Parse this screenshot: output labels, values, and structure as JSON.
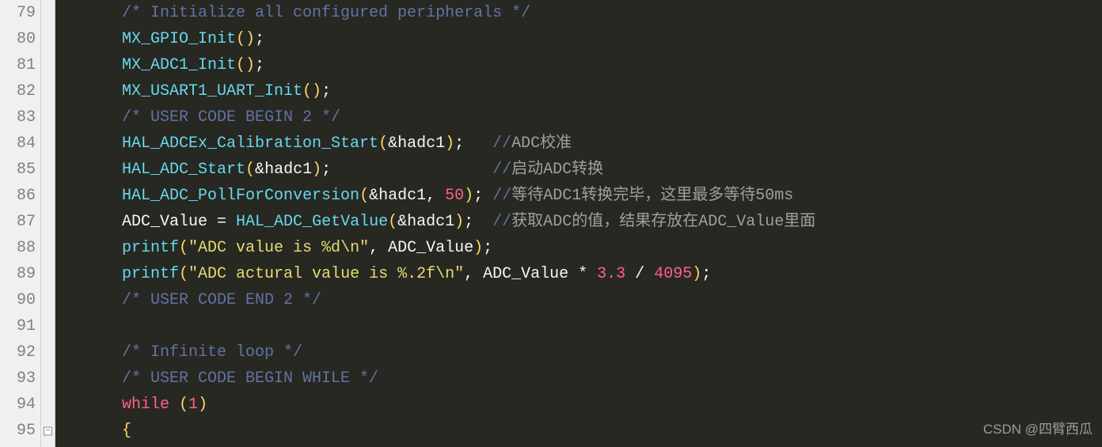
{
  "gutter": {
    "start": 79,
    "end": 95,
    "fold_at": 95
  },
  "code": {
    "l79": {
      "indent": 1,
      "tokens": [
        {
          "t": "/* Initialize all configured peripherals */",
          "c": "c-comment"
        }
      ]
    },
    "l80": {
      "indent": 1,
      "tokens": [
        {
          "t": "MX_GPIO_Init",
          "c": "c-func"
        },
        {
          "t": "()",
          "c": "c-paren"
        },
        {
          "t": ";",
          "c": "c-semi"
        }
      ]
    },
    "l81": {
      "indent": 1,
      "tokens": [
        {
          "t": "MX_ADC1_Init",
          "c": "c-func"
        },
        {
          "t": "()",
          "c": "c-paren"
        },
        {
          "t": ";",
          "c": "c-semi"
        }
      ]
    },
    "l82": {
      "indent": 1,
      "tokens": [
        {
          "t": "MX_USART1_UART_Init",
          "c": "c-func"
        },
        {
          "t": "()",
          "c": "c-paren"
        },
        {
          "t": ";",
          "c": "c-semi"
        }
      ]
    },
    "l83": {
      "indent": 1,
      "tokens": [
        {
          "t": "/* USER CODE BEGIN 2 */",
          "c": "c-comment"
        }
      ]
    },
    "l84": {
      "indent": 1,
      "tokens": [
        {
          "t": "HAL_ADCEx_Calibration_Start",
          "c": "c-func"
        },
        {
          "t": "(",
          "c": "c-paren"
        },
        {
          "t": "&",
          "c": "c-op"
        },
        {
          "t": "hadc1",
          "c": "c-ident"
        },
        {
          "t": ")",
          "c": "c-paren"
        },
        {
          "t": ";",
          "c": "c-semi"
        },
        {
          "t": "   ",
          "c": ""
        },
        {
          "t": "//",
          "c": "c-comment"
        },
        {
          "t": "ADC校准",
          "c": "c-cn"
        }
      ]
    },
    "l85": {
      "indent": 1,
      "tokens": [
        {
          "t": "HAL_ADC_Start",
          "c": "c-func"
        },
        {
          "t": "(",
          "c": "c-paren"
        },
        {
          "t": "&",
          "c": "c-op"
        },
        {
          "t": "hadc1",
          "c": "c-ident"
        },
        {
          "t": ")",
          "c": "c-paren"
        },
        {
          "t": ";",
          "c": "c-semi"
        },
        {
          "t": "                 ",
          "c": ""
        },
        {
          "t": "//",
          "c": "c-comment"
        },
        {
          "t": "启动ADC转换",
          "c": "c-cn"
        }
      ]
    },
    "l86": {
      "indent": 1,
      "tokens": [
        {
          "t": "HAL_ADC_PollForConversion",
          "c": "c-func"
        },
        {
          "t": "(",
          "c": "c-paren"
        },
        {
          "t": "&",
          "c": "c-op"
        },
        {
          "t": "hadc1",
          "c": "c-ident"
        },
        {
          "t": ", ",
          "c": "c-op"
        },
        {
          "t": "50",
          "c": "c-num"
        },
        {
          "t": ")",
          "c": "c-paren"
        },
        {
          "t": ";",
          "c": "c-semi"
        },
        {
          "t": " ",
          "c": ""
        },
        {
          "t": "//",
          "c": "c-comment"
        },
        {
          "t": "等待ADC1转换完毕，这里最多等待50ms",
          "c": "c-cn"
        }
      ]
    },
    "l87": {
      "indent": 1,
      "tokens": [
        {
          "t": "ADC_Value",
          "c": "c-ident"
        },
        {
          "t": " = ",
          "c": "c-op"
        },
        {
          "t": "HAL_ADC_GetValue",
          "c": "c-func"
        },
        {
          "t": "(",
          "c": "c-paren"
        },
        {
          "t": "&",
          "c": "c-op"
        },
        {
          "t": "hadc1",
          "c": "c-ident"
        },
        {
          "t": ")",
          "c": "c-paren"
        },
        {
          "t": ";",
          "c": "c-semi"
        },
        {
          "t": "  ",
          "c": ""
        },
        {
          "t": "//",
          "c": "c-comment"
        },
        {
          "t": "获取ADC的值，结果存放在ADC_Value里面",
          "c": "c-cn"
        }
      ]
    },
    "l88": {
      "indent": 1,
      "tokens": [
        {
          "t": "printf",
          "c": "c-func"
        },
        {
          "t": "(",
          "c": "c-paren"
        },
        {
          "t": "\"ADC value is %d\\n\"",
          "c": "c-str"
        },
        {
          "t": ", ",
          "c": "c-op"
        },
        {
          "t": "ADC_Value",
          "c": "c-ident"
        },
        {
          "t": ")",
          "c": "c-paren"
        },
        {
          "t": ";",
          "c": "c-semi"
        }
      ]
    },
    "l89": {
      "indent": 1,
      "tokens": [
        {
          "t": "printf",
          "c": "c-func"
        },
        {
          "t": "(",
          "c": "c-paren"
        },
        {
          "t": "\"ADC actural value is %.2f\\n\"",
          "c": "c-str"
        },
        {
          "t": ", ",
          "c": "c-op"
        },
        {
          "t": "ADC_Value",
          "c": "c-ident"
        },
        {
          "t": " * ",
          "c": "c-op"
        },
        {
          "t": "3.3",
          "c": "c-num"
        },
        {
          "t": " / ",
          "c": "c-op"
        },
        {
          "t": "4095",
          "c": "c-num"
        },
        {
          "t": ")",
          "c": "c-paren"
        },
        {
          "t": ";",
          "c": "c-semi"
        }
      ]
    },
    "l90": {
      "indent": 1,
      "tokens": [
        {
          "t": "/* USER CODE END 2 */",
          "c": "c-comment"
        }
      ]
    },
    "l91": {
      "indent": 0,
      "tokens": []
    },
    "l92": {
      "indent": 1,
      "tokens": [
        {
          "t": "/* Infinite loop */",
          "c": "c-comment"
        }
      ]
    },
    "l93": {
      "indent": 1,
      "tokens": [
        {
          "t": "/* USER CODE BEGIN WHILE */",
          "c": "c-comment"
        }
      ]
    },
    "l94": {
      "indent": 1,
      "tokens": [
        {
          "t": "while",
          "c": "c-kw"
        },
        {
          "t": " ",
          "c": ""
        },
        {
          "t": "(",
          "c": "c-paren"
        },
        {
          "t": "1",
          "c": "c-num"
        },
        {
          "t": ")",
          "c": "c-paren"
        }
      ]
    },
    "l95": {
      "indent": 1,
      "tokens": [
        {
          "t": "{",
          "c": "c-paren"
        }
      ]
    }
  },
  "watermark": "CSDN @四臂西瓜"
}
